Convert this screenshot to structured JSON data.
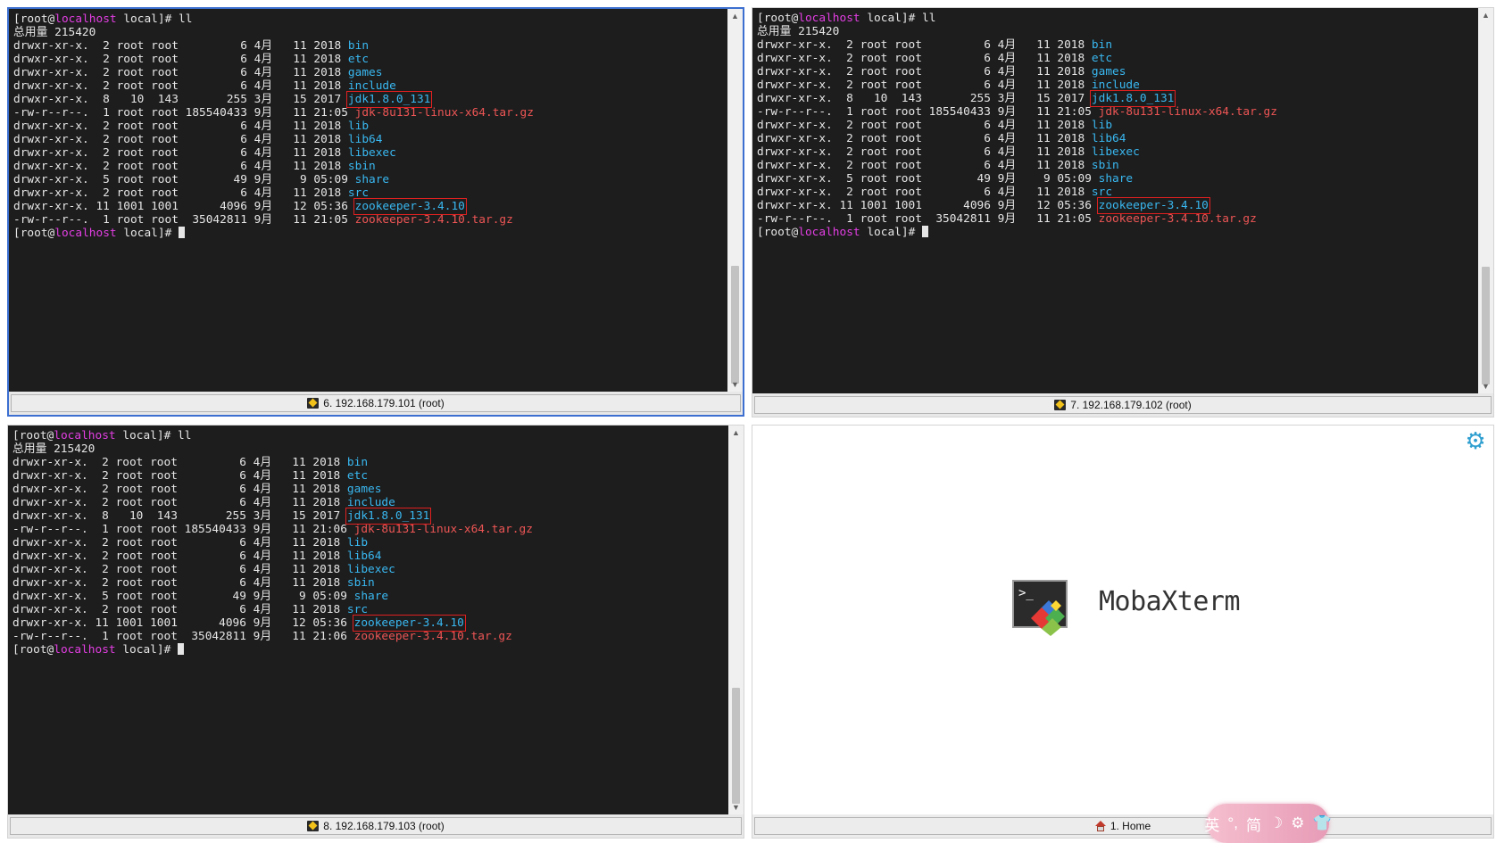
{
  "terminals": [
    {
      "prompt_user": "root",
      "prompt_host": "localhost",
      "prompt_dir": "local",
      "command": "ll",
      "total": "总用量 215420",
      "tab_label": "6. 192.168.179.101 (root)",
      "entries": [
        {
          "meta": "drwxr-xr-x.  2 root root         6 4月   11 2018 ",
          "name": "bin",
          "color": "blue",
          "boxed": false
        },
        {
          "meta": "drwxr-xr-x.  2 root root         6 4月   11 2018 ",
          "name": "etc",
          "color": "blue",
          "boxed": false
        },
        {
          "meta": "drwxr-xr-x.  2 root root         6 4月   11 2018 ",
          "name": "games",
          "color": "blue",
          "boxed": false
        },
        {
          "meta": "drwxr-xr-x.  2 root root         6 4月   11 2018 ",
          "name": "include",
          "color": "blue",
          "boxed": false
        },
        {
          "meta": "drwxr-xr-x.  8   10  143       255 3月   15 2017 ",
          "name": "jdk1.8.0_131",
          "color": "blue",
          "boxed": true
        },
        {
          "meta": "-rw-r--r--.  1 root root 185540433 9月   11 21:05 ",
          "name": "jdk-8u131-linux-x64.tar.gz",
          "color": "red",
          "boxed": false
        },
        {
          "meta": "drwxr-xr-x.  2 root root         6 4月   11 2018 ",
          "name": "lib",
          "color": "blue",
          "boxed": false
        },
        {
          "meta": "drwxr-xr-x.  2 root root         6 4月   11 2018 ",
          "name": "lib64",
          "color": "blue",
          "boxed": false
        },
        {
          "meta": "drwxr-xr-x.  2 root root         6 4月   11 2018 ",
          "name": "libexec",
          "color": "blue",
          "boxed": false
        },
        {
          "meta": "drwxr-xr-x.  2 root root         6 4月   11 2018 ",
          "name": "sbin",
          "color": "blue",
          "boxed": false
        },
        {
          "meta": "drwxr-xr-x.  5 root root        49 9月    9 05:09 ",
          "name": "share",
          "color": "blue",
          "boxed": false
        },
        {
          "meta": "drwxr-xr-x.  2 root root         6 4月   11 2018 ",
          "name": "src",
          "color": "blue",
          "boxed": false
        },
        {
          "meta": "drwxr-xr-x. 11 1001 1001      4096 9月   12 05:36 ",
          "name": "zookeeper-3.4.10",
          "color": "blue",
          "boxed": true
        },
        {
          "meta": "-rw-r--r--.  1 root root  35042811 9月   11 21:05 ",
          "name": "zookeeper-3.4.10.tar.gz",
          "color": "red",
          "boxed": false
        }
      ]
    },
    {
      "prompt_user": "root",
      "prompt_host": "localhost",
      "prompt_dir": "local",
      "command": "ll",
      "total": "总用量 215420",
      "tab_label": "7. 192.168.179.102 (root)",
      "entries": [
        {
          "meta": "drwxr-xr-x.  2 root root         6 4月   11 2018 ",
          "name": "bin",
          "color": "blue",
          "boxed": false
        },
        {
          "meta": "drwxr-xr-x.  2 root root         6 4月   11 2018 ",
          "name": "etc",
          "color": "blue",
          "boxed": false
        },
        {
          "meta": "drwxr-xr-x.  2 root root         6 4月   11 2018 ",
          "name": "games",
          "color": "blue",
          "boxed": false
        },
        {
          "meta": "drwxr-xr-x.  2 root root         6 4月   11 2018 ",
          "name": "include",
          "color": "blue",
          "boxed": false
        },
        {
          "meta": "drwxr-xr-x.  8   10  143       255 3月   15 2017 ",
          "name": "jdk1.8.0_131",
          "color": "blue",
          "boxed": true
        },
        {
          "meta": "-rw-r--r--.  1 root root 185540433 9月   11 21:05 ",
          "name": "jdk-8u131-linux-x64.tar.gz",
          "color": "red",
          "boxed": false
        },
        {
          "meta": "drwxr-xr-x.  2 root root         6 4月   11 2018 ",
          "name": "lib",
          "color": "blue",
          "boxed": false
        },
        {
          "meta": "drwxr-xr-x.  2 root root         6 4月   11 2018 ",
          "name": "lib64",
          "color": "blue",
          "boxed": false
        },
        {
          "meta": "drwxr-xr-x.  2 root root         6 4月   11 2018 ",
          "name": "libexec",
          "color": "blue",
          "boxed": false
        },
        {
          "meta": "drwxr-xr-x.  2 root root         6 4月   11 2018 ",
          "name": "sbin",
          "color": "blue",
          "boxed": false
        },
        {
          "meta": "drwxr-xr-x.  5 root root        49 9月    9 05:09 ",
          "name": "share",
          "color": "blue",
          "boxed": false
        },
        {
          "meta": "drwxr-xr-x.  2 root root         6 4月   11 2018 ",
          "name": "src",
          "color": "blue",
          "boxed": false
        },
        {
          "meta": "drwxr-xr-x. 11 1001 1001      4096 9月   12 05:36 ",
          "name": "zookeeper-3.4.10",
          "color": "blue",
          "boxed": true
        },
        {
          "meta": "-rw-r--r--.  1 root root  35042811 9月   11 21:05 ",
          "name": "zookeeper-3.4.10.tar.gz",
          "color": "red",
          "boxed": false
        }
      ]
    },
    {
      "prompt_user": "root",
      "prompt_host": "localhost",
      "prompt_dir": "local",
      "command": "ll",
      "total": "总用量 215420",
      "tab_label": "8. 192.168.179.103 (root)",
      "entries": [
        {
          "meta": "drwxr-xr-x.  2 root root         6 4月   11 2018 ",
          "name": "bin",
          "color": "blue",
          "boxed": false
        },
        {
          "meta": "drwxr-xr-x.  2 root root         6 4月   11 2018 ",
          "name": "etc",
          "color": "blue",
          "boxed": false
        },
        {
          "meta": "drwxr-xr-x.  2 root root         6 4月   11 2018 ",
          "name": "games",
          "color": "blue",
          "boxed": false
        },
        {
          "meta": "drwxr-xr-x.  2 root root         6 4月   11 2018 ",
          "name": "include",
          "color": "blue",
          "boxed": false
        },
        {
          "meta": "drwxr-xr-x.  8   10  143       255 3月   15 2017 ",
          "name": "jdk1.8.0_131",
          "color": "blue",
          "boxed": true
        },
        {
          "meta": "-rw-r--r--.  1 root root 185540433 9月   11 21:06 ",
          "name": "jdk-8u131-linux-x64.tar.gz",
          "color": "red",
          "boxed": false
        },
        {
          "meta": "drwxr-xr-x.  2 root root         6 4月   11 2018 ",
          "name": "lib",
          "color": "blue",
          "boxed": false
        },
        {
          "meta": "drwxr-xr-x.  2 root root         6 4月   11 2018 ",
          "name": "lib64",
          "color": "blue",
          "boxed": false
        },
        {
          "meta": "drwxr-xr-x.  2 root root         6 4月   11 2018 ",
          "name": "libexec",
          "color": "blue",
          "boxed": false
        },
        {
          "meta": "drwxr-xr-x.  2 root root         6 4月   11 2018 ",
          "name": "sbin",
          "color": "blue",
          "boxed": false
        },
        {
          "meta": "drwxr-xr-x.  5 root root        49 9月    9 05:09 ",
          "name": "share",
          "color": "blue",
          "boxed": false
        },
        {
          "meta": "drwxr-xr-x.  2 root root         6 4月   11 2018 ",
          "name": "src",
          "color": "blue",
          "boxed": false
        },
        {
          "meta": "drwxr-xr-x. 11 1001 1001      4096 9月   12 05:36 ",
          "name": "zookeeper-3.4.10",
          "color": "blue",
          "boxed": true
        },
        {
          "meta": "-rw-r--r--.  1 root root  35042811 9月   11 21:06 ",
          "name": "zookeeper-3.4.10.tar.gz",
          "color": "red",
          "boxed": false
        }
      ]
    }
  ],
  "home": {
    "brand": "MobaXterm",
    "tab_label": "1. Home",
    "settings_icon": "gear-icon"
  },
  "ime_toolbar": {
    "lang": "英",
    "mode": "简",
    "icons": [
      "punctuation-icon",
      "moon-icon",
      "gear-icon",
      "shirt-icon"
    ]
  },
  "colors": {
    "dir": "#39b8f1",
    "archive": "#ee5555",
    "host": "#e23ee2",
    "active_border": "#3c6fd0"
  }
}
